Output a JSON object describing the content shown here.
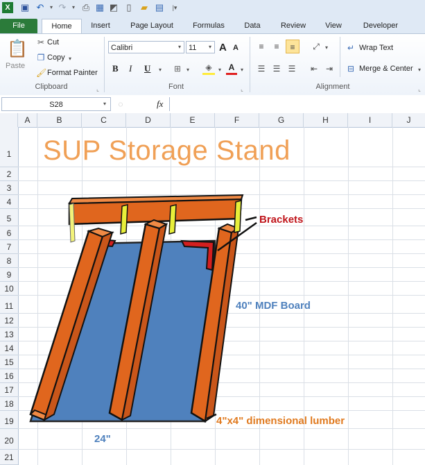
{
  "qat": {
    "app_icon": "excel-icon",
    "icons": [
      "save-icon",
      "undo-icon",
      "redo-icon",
      "print-icon",
      "print-preview-icon",
      "zoom-icon",
      "new-icon",
      "open-icon",
      "layout-icon",
      "customize-icon"
    ]
  },
  "tabs": [
    "File",
    "Home",
    "Insert",
    "Page Layout",
    "Formulas",
    "Data",
    "Review",
    "View",
    "Developer"
  ],
  "ribbon": {
    "clipboard": {
      "paste": "Paste",
      "cut": "Cut",
      "copy": "Copy",
      "format_painter": "Format Painter",
      "label": "Clipboard"
    },
    "font": {
      "name": "Calibri",
      "size": "11",
      "bold": "B",
      "italic": "I",
      "underline": "U",
      "grow": "A",
      "shrink": "A",
      "label": "Font"
    },
    "alignment": {
      "wrap": "Wrap Text",
      "merge": "Merge & Center",
      "label": "Alignment"
    }
  },
  "formula_bar": {
    "name_box": "S28",
    "fx": "fx",
    "value": ""
  },
  "columns": [
    "A",
    "B",
    "C",
    "D",
    "E",
    "F",
    "G",
    "H",
    "I",
    "J"
  ],
  "rows": [
    "1",
    "2",
    "3",
    "4",
    "5",
    "6",
    "7",
    "8",
    "9",
    "10",
    "11",
    "12",
    "13",
    "14",
    "15",
    "16",
    "17",
    "18",
    "19",
    "20",
    "21"
  ],
  "sheet": {
    "title": "SUP Storage Stand",
    "labels": {
      "brackets": "Brackets",
      "mdf": "40\" MDF Board",
      "lumber": "4\"x4\" dimensional lumber",
      "width": "24\""
    }
  },
  "colors": {
    "title": "#f0a056",
    "wood": "#e0661e",
    "board": "#4f81bd",
    "bracket_red": "#d31f1f",
    "bracket_yellow": "#e8ef3a",
    "label_red": "#c0151b",
    "label_blue": "#4f81bd",
    "label_orange": "#e07a1f",
    "file_tab": "#2b7b3a"
  }
}
